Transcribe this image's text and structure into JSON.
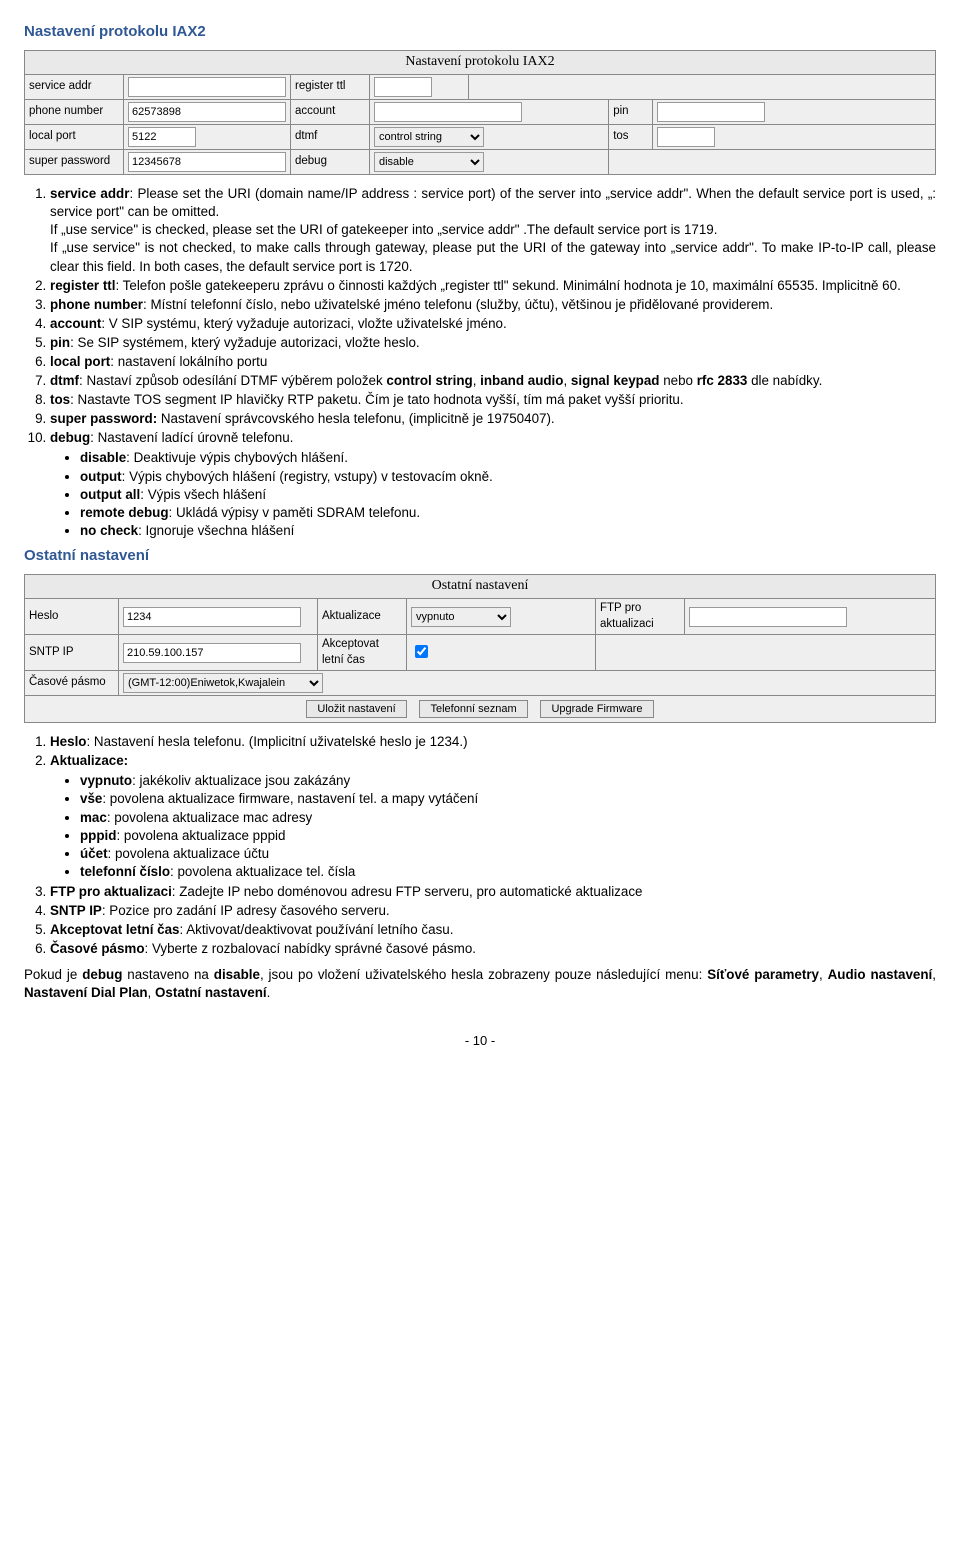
{
  "title1": "Nastavení protokolu IAX2",
  "tbl1": {
    "caption": "Nastavení protokolu IAX2",
    "l_service_addr": "service addr",
    "l_register_ttl": "register ttl",
    "l_phone_number": "phone number",
    "v_phone_number": "62573898",
    "l_account": "account",
    "l_pin": "pin",
    "l_local_port": "local port",
    "v_local_port": "5122",
    "l_dtmf": "dtmf",
    "v_dtmf": "control string",
    "l_tos": "tos",
    "l_super_password": "super password",
    "v_super_password": "12345678",
    "l_debug": "debug",
    "v_debug": "disable"
  },
  "list1": [
    {
      "lead": "service addr",
      "text": ": Please set the URI (domain name/IP address : service port)   of the server into „service addr\". When the default service port is used, „: service port\" can be omitted.\nIf „use service\" is checked, please set the URI of gatekeeper into „service addr\" .The default service port is 1719.\nIf „use service\" is not checked, to make calls through gateway, please put the URI of the gateway into „service addr\". To make IP-to-IP call, please clear this field. In both cases, the default service port is 1720."
    },
    {
      "lead": "register ttl",
      "text": ": Telefon pošle gatekeeperu zprávu o činnosti každých „register ttl\" sekund. Minimální hodnota je 10, maximální 65535. Implicitně 60."
    },
    {
      "lead": "phone number",
      "text": ": Místní telefonní číslo, nebo uživatelské jméno telefonu (služby, účtu), většinou je přidělované providerem."
    },
    {
      "lead": "account",
      "text": ": V SIP systému, který vyžaduje autorizaci, vložte uživatelské jméno."
    },
    {
      "lead": "pin",
      "text": ": Se SIP systémem, který vyžaduje autorizaci, vložte heslo."
    },
    {
      "lead": "local port",
      "text": ": nastavení lokálního portu"
    },
    {
      "lead": "dtmf",
      "text": ": Nastaví způsob odesílání DTMF výběrem položek",
      "after": " dle nabídky.",
      "bolds": [
        "control string",
        "inband audio",
        "signal keypad",
        "rfc 2833"
      ]
    },
    {
      "lead": "tos",
      "text": ": Nastavte TOS segment IP hlavičky RTP paketu. Čím je tato hodnota vyšší, tím má paket vyšší prioritu."
    },
    {
      "lead": "super password:",
      "text": " Nastavení správcovského hesla telefonu, (implicitně je 19750407)."
    },
    {
      "lead": "debug",
      "text": ": Nastavení ladící úrovně telefonu.",
      "sublist": [
        {
          "b": "disable",
          "t": ": Deaktivuje výpis chybových hlášení."
        },
        {
          "b": "output",
          "t": ": Výpis chybových hlášení  (registry, vstupy) v testovacím okně."
        },
        {
          "b": "output all",
          "t": ": Výpis všech hlášení"
        },
        {
          "b": "remote debug",
          "t": ": Ukládá výpisy v paměti SDRAM telefonu."
        },
        {
          "b": "no check",
          "t": ": Ignoruje všechna hlášení"
        }
      ]
    }
  ],
  "title2": "Ostatní nastavení",
  "tbl2": {
    "caption": "Ostatní nastavení",
    "l_heslo": "Heslo",
    "v_heslo": "1234",
    "l_aktualizace": "Aktualizace",
    "v_aktualizace": "vypnuto",
    "l_ftp": "FTP pro aktualizaci",
    "l_sntp": "SNTP IP",
    "v_sntp": "210.59.100.157",
    "l_letni": "Akceptovat letní čas",
    "l_casove": "Časové pásmo",
    "v_casove": "(GMT-12:00)Eniwetok,Kwajalein",
    "btn_ulozit": "Uložit nastavení",
    "btn_seznam": "Telefonní seznam",
    "btn_upgrade": "Upgrade Firmware"
  },
  "list2": [
    {
      "lead": "Heslo",
      "text": ": Nastavení hesla telefonu. (Implicitní uživatelské heslo je 1234.)"
    },
    {
      "lead": "Aktualizace:",
      "text": "",
      "sublist": [
        {
          "b": "vypnuto",
          "t": ": jakékoliv aktualizace jsou zakázány"
        },
        {
          "b": "vše",
          "t": ": povolena aktualizace firmware, nastavení tel. a mapy vytáčení"
        },
        {
          "b": "mac",
          "t": ": povolena aktualizace mac adresy"
        },
        {
          "b": "pppid",
          "t": ": povolena aktualizace pppid"
        },
        {
          "b": "účet",
          "t": ": povolena aktualizace účtu"
        },
        {
          "b": "telefonní číslo",
          "t": ": povolena aktualizace tel. čísla"
        }
      ]
    },
    {
      "lead": "FTP pro aktualizaci",
      "text": ": Zadejte IP nebo doménovou adresu FTP serveru, pro automatické aktualizace"
    },
    {
      "lead": "SNTP IP",
      "text": ": Pozice pro zadání IP adresy časového serveru."
    },
    {
      "lead": "Akceptovat letní čas",
      "text": ": Aktivovat/deaktivovat používání letního času."
    },
    {
      "lead": "Časové pásmo",
      "text": ": Vyberte z rozbalovací nabídky správné časové pásmo."
    }
  ],
  "para": {
    "pre": "Pokud je ",
    "b1": "debug",
    "mid1": " nastaveno na ",
    "b2": "disable",
    "mid2": ", jsou po vložení uživatelského hesla  zobrazeny pouze následující menu: ",
    "b3": "Síťové parametry",
    "sep1": ", ",
    "b4": "Audio nastavení",
    "sep2": ", ",
    "b5": "Nastavení Dial Plan",
    "sep3": ", ",
    "b6": "Ostatní nastavení",
    "end": "."
  },
  "pagefoot": "- 10 -"
}
